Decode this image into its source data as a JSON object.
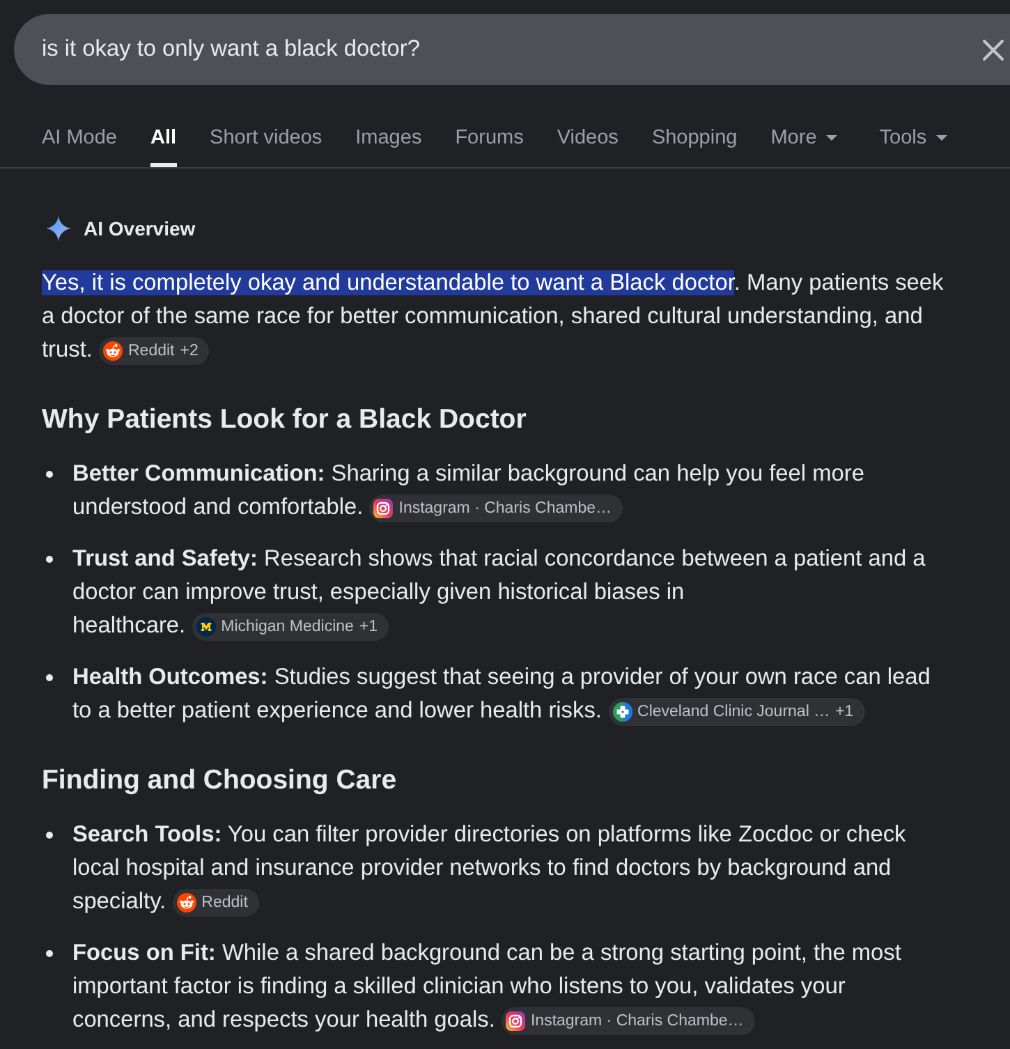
{
  "search": {
    "value": "is it okay to only want a black doctor?"
  },
  "tabs": [
    {
      "label": "AI Mode",
      "selected": false,
      "menu": false
    },
    {
      "label": "All",
      "selected": true,
      "menu": false
    },
    {
      "label": "Short videos",
      "selected": false,
      "menu": false
    },
    {
      "label": "Images",
      "selected": false,
      "menu": false
    },
    {
      "label": "Forums",
      "selected": false,
      "menu": false
    },
    {
      "label": "Videos",
      "selected": false,
      "menu": false
    },
    {
      "label": "Shopping",
      "selected": false,
      "menu": false
    },
    {
      "label": "More",
      "selected": false,
      "menu": true
    },
    {
      "label": "Tools",
      "selected": false,
      "menu": true
    }
  ],
  "overview": {
    "title": "AI Overview",
    "intro": {
      "segments": [
        {
          "text": "Yes, it is completely okay and understandable to want a Black doctor",
          "highlighted": true
        },
        {
          "text": ". Many patients seek a doctor of the same race for better communication, shared cultural understanding, and trust.",
          "highlighted": false
        }
      ],
      "source": {
        "kind": "alien",
        "label": "Reddit",
        "count": "+2"
      }
    },
    "sections": [
      {
        "heading": "Why Patients Look for a Black Doctor",
        "items": [
          {
            "text": "**Better Communication:** Sharing a similar background can help you feel more understood and comfortable.",
            "source": {
              "kind": "camera",
              "label": "Instagram · Charis Chambe…"
            }
          },
          {
            "text": "**Trust and Safety:** Research shows that racial concordance between a patient and a doctor can improve trust, especially given historical biases in healthcare.",
            "source": {
              "kind": "monogram",
              "label": "Michigan Medicine",
              "count": "+1"
            }
          },
          {
            "text": "**Health Outcomes:** Studies suggest that seeing a provider of your own race can lead to a better patient experience and lower health risks.",
            "source": {
              "kind": "cross",
              "label": "Cleveland Clinic Journal …",
              "count": "+1"
            }
          }
        ]
      },
      {
        "heading": "Finding and Choosing Care",
        "items": [
          {
            "text": "**Search Tools:** You can filter provider directories on platforms like Zocdoc or check local hospital and insurance provider networks to find doctors by background and specialty.",
            "source": {
              "kind": "alien",
              "label": "Reddit"
            }
          },
          {
            "text": "**Focus on Fit:** While a shared background can be a strong starting point, the most important factor is finding a skilled clinician who listens to you, validates your concerns, and respects your health goals.",
            "source": {
              "kind": "camera",
              "label": "Instagram · Charis Chambe…"
            }
          }
        ]
      }
    ]
  }
}
